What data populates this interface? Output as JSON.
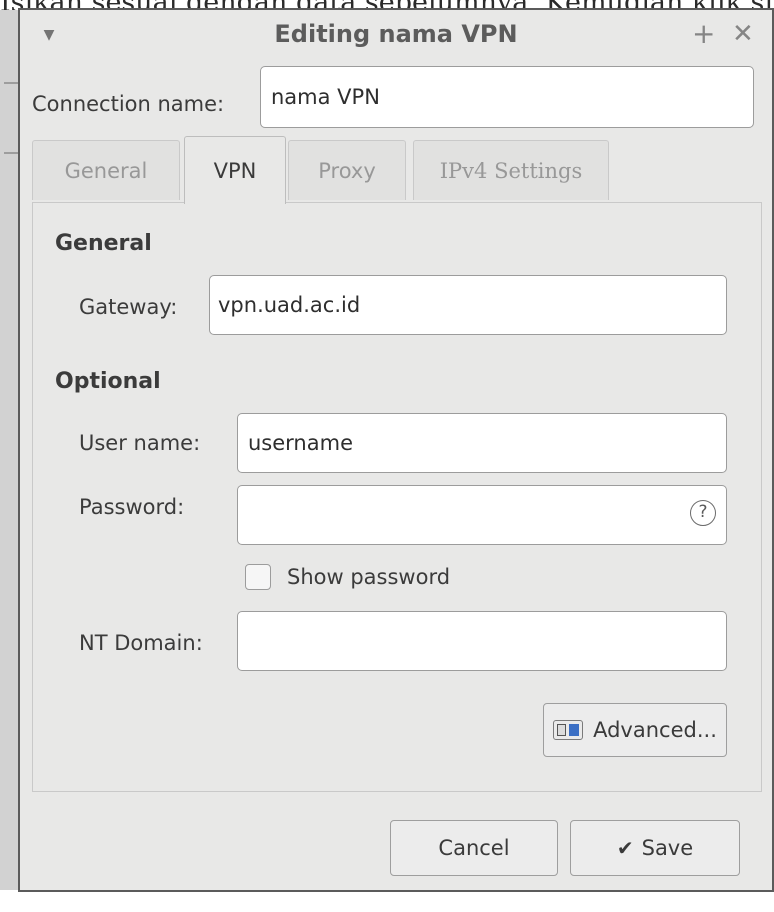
{
  "background": {
    "caption_text": "Isikan sesuai dengan data sebelumnya. Kemudian klik simpan."
  },
  "dialog": {
    "title": "Editing nama VPN",
    "connection_name_label": "Connection name:",
    "connection_name_value": "nama VPN",
    "tabs": [
      {
        "label": "General",
        "active": false
      },
      {
        "label": "VPN",
        "active": true
      },
      {
        "label": "Proxy",
        "active": false
      },
      {
        "label": "IPv4 Settings",
        "active": false
      }
    ],
    "general_section": {
      "heading": "General",
      "gateway_label": "Gateway:",
      "gateway_value": "vpn.uad.ac.id"
    },
    "optional_section": {
      "heading": "Optional",
      "username_label": "User name:",
      "username_value": "username",
      "password_label": "Password:",
      "password_value": "",
      "password_help_glyph": "?",
      "show_password_label": "Show password",
      "show_password_checked": false,
      "nt_domain_label": "NT Domain:",
      "nt_domain_value": ""
    },
    "advanced_button_label": "Advanced...",
    "cancel_button_label": "Cancel",
    "save_button_label": "Save",
    "icons": {
      "window_menu": "chevron-down-icon",
      "maximize": "plus-icon",
      "close": "close-icon",
      "password_help": "question-circle-icon",
      "advanced": "settings-panel-icon",
      "save": "checkmark-icon"
    },
    "colors": {
      "dialog_bg": "#e8e8e7",
      "input_bg": "#ffffff",
      "advanced_icon_accent": "#3b6fc4"
    }
  }
}
